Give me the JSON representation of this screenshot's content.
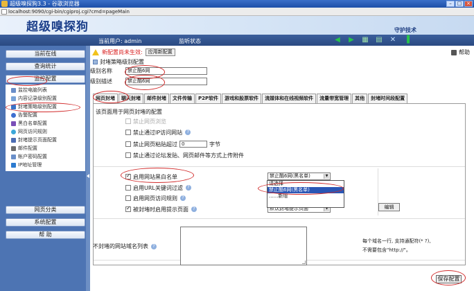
{
  "window": {
    "title": "超级嗅探狗3.3 - 谷歌浏览器",
    "url": "localhost:9090/cgi-bin/cgiproj.cgi?cmd=pageMain"
  },
  "banner": {
    "logo": "超级嗅探狗",
    "maintenance": "守护技术"
  },
  "statusbar": {
    "user": "当前用户: admin",
    "monitor": "监听状态"
  },
  "sidebar": {
    "sections": [
      {
        "label": "当前在线"
      },
      {
        "label": "查询统计"
      },
      {
        "label": "监控配置"
      }
    ],
    "items": [
      {
        "label": "监控电脑列表",
        "color": "#6a8fc9"
      },
      {
        "label": "内容记录级别配置",
        "color": "#7aa4d9"
      },
      {
        "label": "封堵策略级别配置",
        "color": "#3a74c9"
      },
      {
        "label": "告警配置",
        "color": "#3e6fd0"
      },
      {
        "label": "黑白名单配置",
        "color": "#7a4fb8"
      },
      {
        "label": "网页访问规则",
        "color": "#3ca7d8"
      },
      {
        "label": "封堵提示页面配置",
        "color": "#4c6db3"
      },
      {
        "label": "邮件配置",
        "color": "#6d6d6d"
      },
      {
        "label": "帐户密码配置",
        "color": "#6a8fc9"
      },
      {
        "label": "IP地址管理",
        "color": "#2c7bd0"
      }
    ],
    "bottom": [
      {
        "label": "网页分类"
      },
      {
        "label": "系统配置"
      },
      {
        "label": "帮    助"
      }
    ]
  },
  "main": {
    "warning": "新配置尚未生效:",
    "apply_button": "应用新配置",
    "help": "帮助",
    "page_title": "封堵策略级别配置",
    "level_name_label": "级别名称",
    "level_name_value": "禁止酷6网",
    "level_desc_label": "级别描述",
    "level_desc_value": "禁止酷6网",
    "tabs": [
      "网页封堵",
      "聊天封堵",
      "邮件封堵",
      "文件传输",
      "P2P软件",
      "游戏和股票软件",
      "流媒体和在线视频软件",
      "流量带宽管理",
      "其他",
      "封堵时间段配置"
    ],
    "intro": "该页面用于网页封堵的配置",
    "options": {
      "ban_web": "禁止网页浏览",
      "ban_ip": "禁止通过IP访问网站",
      "ban_paste": "禁止网页粘贴超过",
      "paste_value": "0",
      "paste_unit": "字节",
      "ban_upload": "禁止通过论坛发贴、网页邮件等方式上传附件",
      "blacklist": "启用网站黑白名单",
      "url_filter": "启用URL关键词过滤",
      "access_rules": "启用网页访问规则",
      "show_page": "被封堵时启用提示页面"
    },
    "blacklist_select": "禁止酷6网(黑名单)",
    "dropdown_options": [
      "请选择",
      "禁止酷6网(黑名单)",
      "......新增"
    ],
    "page_select": "默认封堵提示页面",
    "edit_button": "编辑",
    "unblocked_label": "不封堵的网站域名列表",
    "note1": "每个域名一行, 支持通配符(* ?),",
    "note2": "不需要包含\"http://\"。",
    "save_button": "保存配置"
  }
}
